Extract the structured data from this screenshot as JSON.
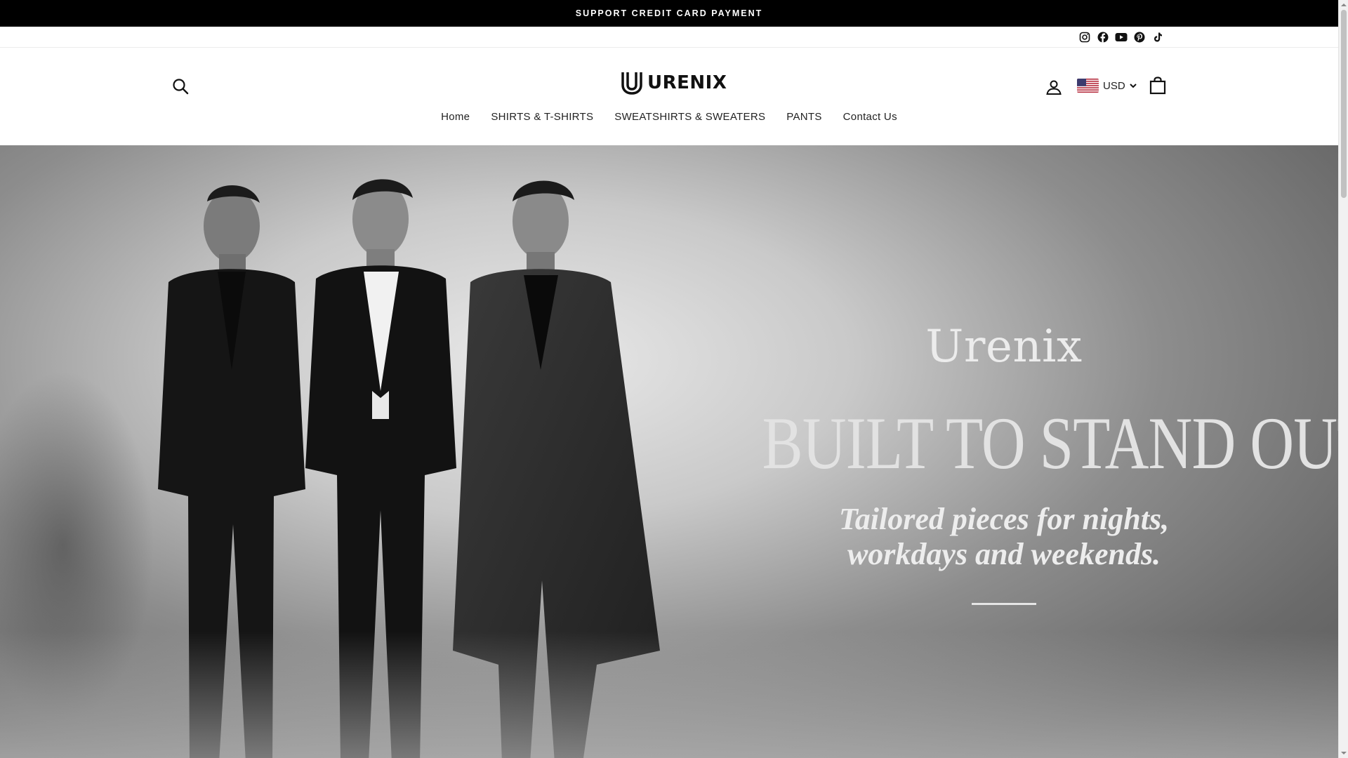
{
  "announcement": {
    "text": "SUPPORT CREDIT CARD PAYMENT"
  },
  "social": {
    "icons": [
      "instagram-icon",
      "facebook-icon",
      "youtube-icon",
      "pinterest-icon",
      "tiktok-icon"
    ]
  },
  "header": {
    "logo_text": "URENIX",
    "currency": {
      "selected": "USD",
      "flag": "us-flag"
    }
  },
  "nav": {
    "items": [
      {
        "label": "Home"
      },
      {
        "label": "SHIRTS & T-SHIRTS"
      },
      {
        "label": "SWEATSHIRTS & SWEATERS"
      },
      {
        "label": "PANTS"
      },
      {
        "label": "Contact Us"
      }
    ]
  },
  "hero": {
    "brand": "Urenix",
    "headline": "BUILT TO STAND OUT",
    "sub_line1": "Tailored pieces for nights,",
    "sub_line2": "workdays and weekends."
  },
  "colors": {
    "announcement_bg": "#000000",
    "text": "#111111",
    "hero_text": "#e6e6e6"
  }
}
